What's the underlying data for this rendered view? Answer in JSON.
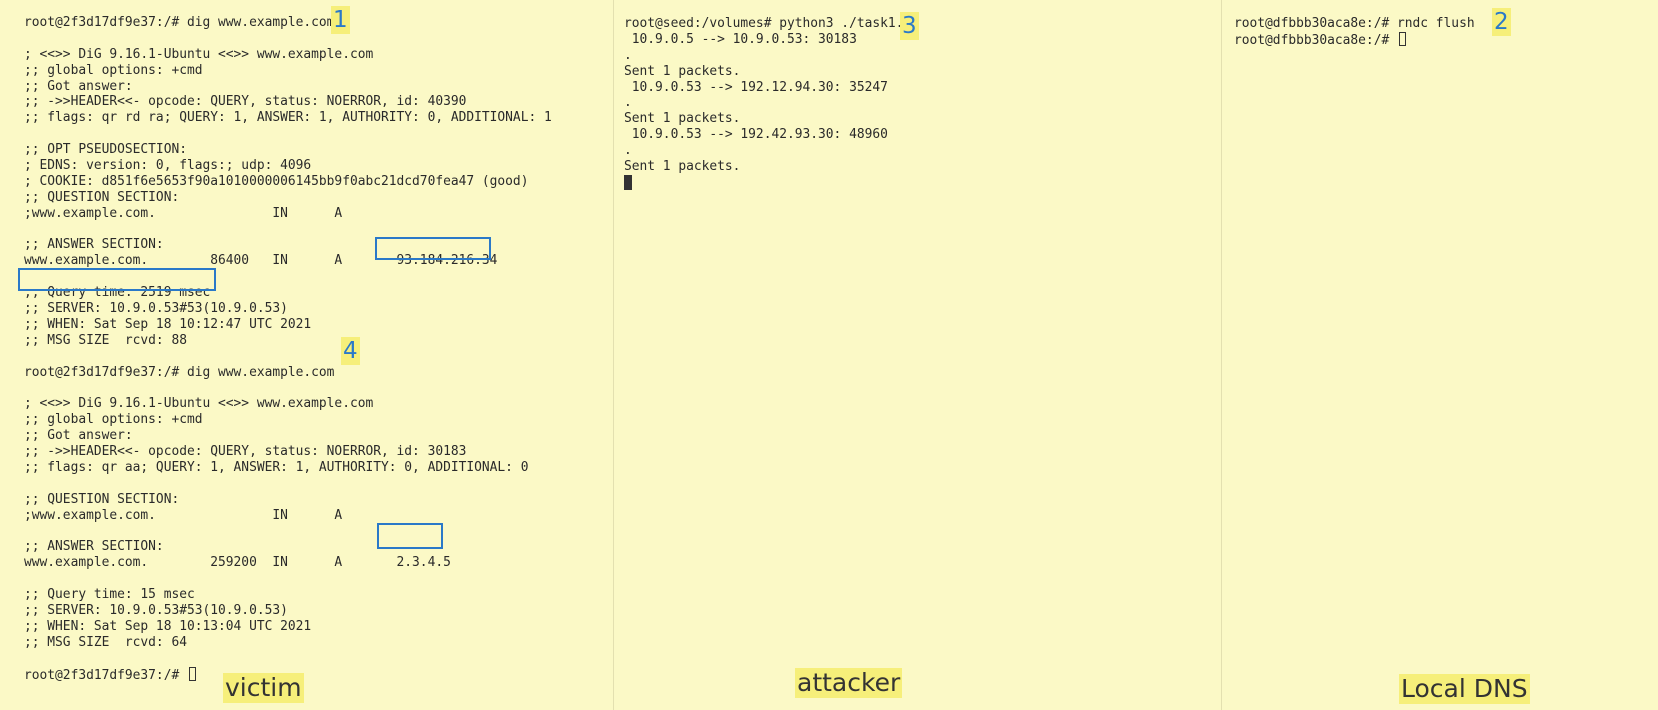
{
  "panes": {
    "victim": {
      "label": "victim",
      "lines": [
        "root@2f3d17df9e37:/# dig www.example.com",
        "",
        "; <<>> DiG 9.16.1-Ubuntu <<>> www.example.com",
        ";; global options: +cmd",
        ";; Got answer:",
        ";; ->>HEADER<<- opcode: QUERY, status: NOERROR, id: 40390",
        ";; flags: qr rd ra; QUERY: 1, ANSWER: 1, AUTHORITY: 0, ADDITIONAL: 1",
        "",
        ";; OPT PSEUDOSECTION:",
        "; EDNS: version: 0, flags:; udp: 4096",
        "; COOKIE: d851f6e5653f90a1010000006145bb9f0abc21dcd70fea47 (good)",
        ";; QUESTION SECTION:",
        ";www.example.com.               IN      A",
        "",
        ";; ANSWER SECTION:",
        "www.example.com.        86400   IN      A       93.184.216.34",
        "",
        ";; Query time: 2519 msec",
        ";; SERVER: 10.9.0.53#53(10.9.0.53)",
        ";; WHEN: Sat Sep 18 10:12:47 UTC 2021",
        ";; MSG SIZE  rcvd: 88",
        "",
        "root@2f3d17df9e37:/# dig www.example.com",
        "",
        "; <<>> DiG 9.16.1-Ubuntu <<>> www.example.com",
        ";; global options: +cmd",
        ";; Got answer:",
        ";; ->>HEADER<<- opcode: QUERY, status: NOERROR, id: 30183",
        ";; flags: qr aa; QUERY: 1, ANSWER: 1, AUTHORITY: 0, ADDITIONAL: 0",
        "",
        ";; QUESTION SECTION:",
        ";www.example.com.               IN      A",
        "",
        ";; ANSWER SECTION:",
        "www.example.com.        259200  IN      A       2.3.4.5",
        "",
        ";; Query time: 15 msec",
        ";; SERVER: 10.9.0.53#53(10.9.0.53)",
        ";; WHEN: Sat Sep 18 10:13:04 UTC 2021",
        ";; MSG SIZE  rcvd: 64",
        "",
        "root@2f3d17df9e37:/# "
      ]
    },
    "attacker": {
      "label": "attacker",
      "lines": [
        "root@seed:/volumes# python3 ./task1.py",
        " 10.9.0.5 --> 10.9.0.53: 30183",
        ".",
        "Sent 1 packets.",
        " 10.9.0.53 --> 192.12.94.30: 35247",
        ".",
        "Sent 1 packets.",
        " 10.9.0.53 --> 192.42.93.30: 48960",
        ".",
        "Sent 1 packets."
      ]
    },
    "local_dns": {
      "label": "Local DNS",
      "lines": [
        "root@dfbbb30aca8e:/# rndc flush",
        "root@dfbbb30aca8e:/# "
      ]
    }
  },
  "step_markers": [
    "1",
    "2",
    "3",
    "4"
  ]
}
